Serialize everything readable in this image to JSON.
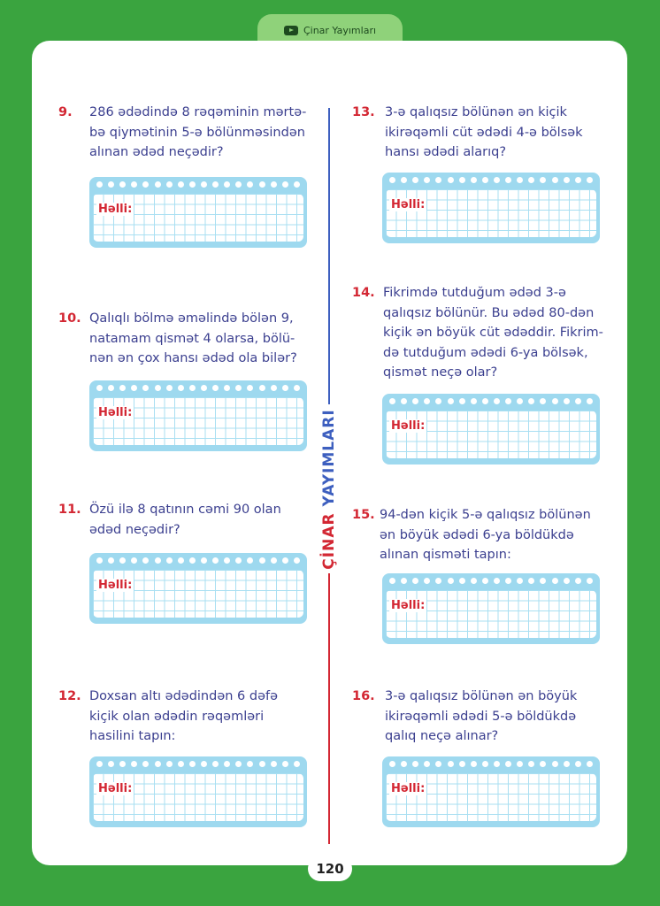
{
  "header": {
    "publisher": "Çinar Yayımları",
    "icon": "play-icon"
  },
  "brand_vertical": {
    "part1": "ÇİNAR",
    "part2": "YAYIMLARI"
  },
  "solution_label": "Həlli:",
  "questions": [
    {
      "number": "9.",
      "text": "286 ədədində 8 rəqəminin mərtə-\nbə qiymətinin 5-ə bölünməsindən\nalınan ədəd neçədir?"
    },
    {
      "number": "10.",
      "text": "Qalıqlı bölmə əməlində bölən 9,\nnatamam qismət 4 olarsa, bölü-\nnən ən çox hansı ədəd ola bilər?"
    },
    {
      "number": "11.",
      "text": "Özü ilə 8 qatının cəmi 90 olan\nədəd neçədir?"
    },
    {
      "number": "12.",
      "text": "Doxsan altı ədədindən 6 dəfə\nkiçik olan ədədin rəqəmləri\nhasilini tapın:"
    },
    {
      "number": "13.",
      "text": "3-ə qalıqsız bölünən ən kiçik\nikirəqəmli cüt ədədi 4-ə bölsək\nhansı ədədi alarıq?"
    },
    {
      "number": "14.",
      "text": "Fikrimdə tutduğum ədəd 3-ə\nqalıqsız bölünür. Bu ədəd 80-dən\nkiçik ən böyük cüt ədəddir. Fikrim-\ndə tutduğum ədədi 6-ya bölsək,\nqismət neçə olar?"
    },
    {
      "number": "15.",
      "text": "94-dən kiçik 5-ə qalıqsız bölünən\nən böyük ədədi 6-ya böldükdə\nalınan qisməti tapın:"
    },
    {
      "number": "16.",
      "text": "3-ə qalıqsız bölünən ən böyük\nikirəqəmli ədədi 5-ə böldükdə\nqalıq neçə alınar?"
    }
  ],
  "page_number": "120"
}
